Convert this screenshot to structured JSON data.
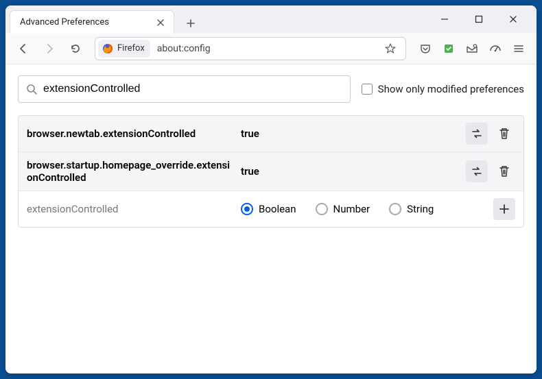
{
  "window": {
    "tab_title": "Advanced Preferences"
  },
  "toolbar": {
    "identity_label": "Firefox",
    "url": "about:config"
  },
  "search": {
    "value": "extensionControlled",
    "checkbox_label": "Show only modified preferences"
  },
  "prefs": [
    {
      "name": "browser.newtab.extensionControlled",
      "value": "true"
    },
    {
      "name": "browser.startup.homepage_override.extensionControlled",
      "value": "true"
    }
  ],
  "new_pref": {
    "name": "extensionControlled",
    "types": [
      "Boolean",
      "Number",
      "String"
    ],
    "selected": "Boolean"
  }
}
